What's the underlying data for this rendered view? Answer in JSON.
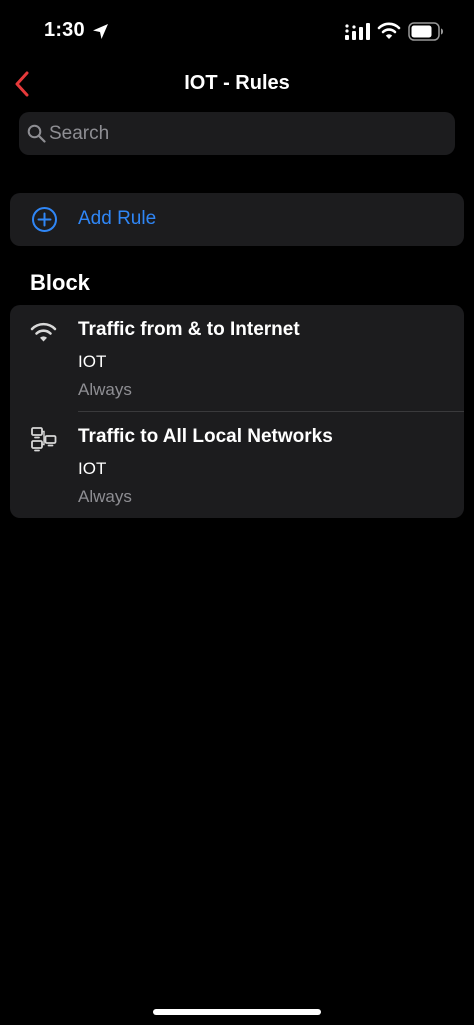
{
  "status_bar": {
    "time": "1:30"
  },
  "nav": {
    "title": "IOT - Rules",
    "back_label": "Back"
  },
  "search": {
    "placeholder": "Search",
    "value": ""
  },
  "add_rule": {
    "label": "Add Rule"
  },
  "section": {
    "title": "Block"
  },
  "rules": [
    {
      "icon": "wifi-icon",
      "title": "Traffic from & to Internet",
      "network": "IOT",
      "schedule": "Always"
    },
    {
      "icon": "local-networks-icon",
      "title": "Traffic to All Local Networks",
      "network": "IOT",
      "schedule": "Always"
    }
  ],
  "colors": {
    "background": "#000000",
    "cell": "#1c1c1e",
    "accent_blue": "#2f86f6",
    "back_red": "#e5393a",
    "secondary_text": "#8e8e93"
  }
}
